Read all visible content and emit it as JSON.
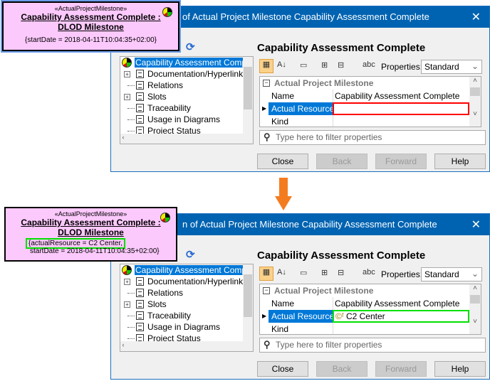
{
  "top": {
    "node": {
      "stereotype": "«ActualProjectMilestone»",
      "name_line1": "Capability Assessment Complete :",
      "name_line2": "DLOD Milestone",
      "tag_line1": "{startDate = 2018-04-11T10:04:35+02:00}",
      "tag_line2": ""
    },
    "dialog": {
      "title": "of Actual Project Milestone Capability Assessment Complete",
      "actual_resource": ""
    }
  },
  "bottom": {
    "node": {
      "stereotype": "«ActualProjectMilestone»",
      "name_line1": "Capability Assessment Complete :",
      "name_line2": "DLOD Milestone",
      "tag_line1": "{actualResource = C2 Center,",
      "tag_line2": "startDate = 2018-04-11T10:04:35+02:00}"
    },
    "dialog": {
      "title": "n of Actual Project Milestone Capability Assessment Complete",
      "actual_resource": "C2 Center",
      "actual_resource_icon": "©ᶠ"
    }
  },
  "dialog": {
    "close_icon": "✕",
    "header": "Capability Assessment Complete",
    "tree": [
      "Capability Assessment Complete",
      "Documentation/Hyperlinks",
      "Relations",
      "Slots",
      "Traceability",
      "Usage in Diagrams",
      "Project Status"
    ],
    "properties_label": "Properties:",
    "properties_value": "Standard",
    "group": "Actual Project Milestone",
    "rows": [
      {
        "key": "Name",
        "value": "Capability Assessment Complete"
      },
      {
        "key": "Actual Resource"
      },
      {
        "key": "Kind",
        "value": ""
      }
    ],
    "filter_placeholder": "Type here to filter properties",
    "buttons": {
      "close": "Close",
      "back": "Back",
      "forward": "Forward",
      "help": "Help"
    }
  },
  "colors": {
    "highlight_before": "#ff0000",
    "highlight_after": "#00e000",
    "arrow": "#f47c20",
    "titlebar": "#0063b1"
  }
}
